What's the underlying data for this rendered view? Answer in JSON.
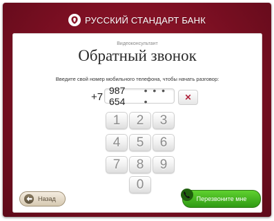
{
  "header": {
    "brand": "РУССКИЙ СТАНДАРТ БАНК",
    "logo_icon": "bank-logo-icon"
  },
  "page": {
    "eyebrow": "Видеоконсультант",
    "title": "Обратный звонок",
    "instruction": "Введите свой номер мобильного телефона, чтобы начать разговор:"
  },
  "phone": {
    "prefix": "+7",
    "value": "987 654",
    "mask": "• • • •",
    "clear_label": "✕"
  },
  "keypad": {
    "k1": "1",
    "k2": "2",
    "k3": "3",
    "k4": "4",
    "k5": "5",
    "k6": "6",
    "k7": "7",
    "k8": "8",
    "k9": "9",
    "k0": "0"
  },
  "footer": {
    "back_label": "Назад",
    "call_label": "Перезвоните мне"
  },
  "colors": {
    "frame": "#7a0f22",
    "call_button": "#3aa51a",
    "back_button": "#d6c9b1"
  }
}
